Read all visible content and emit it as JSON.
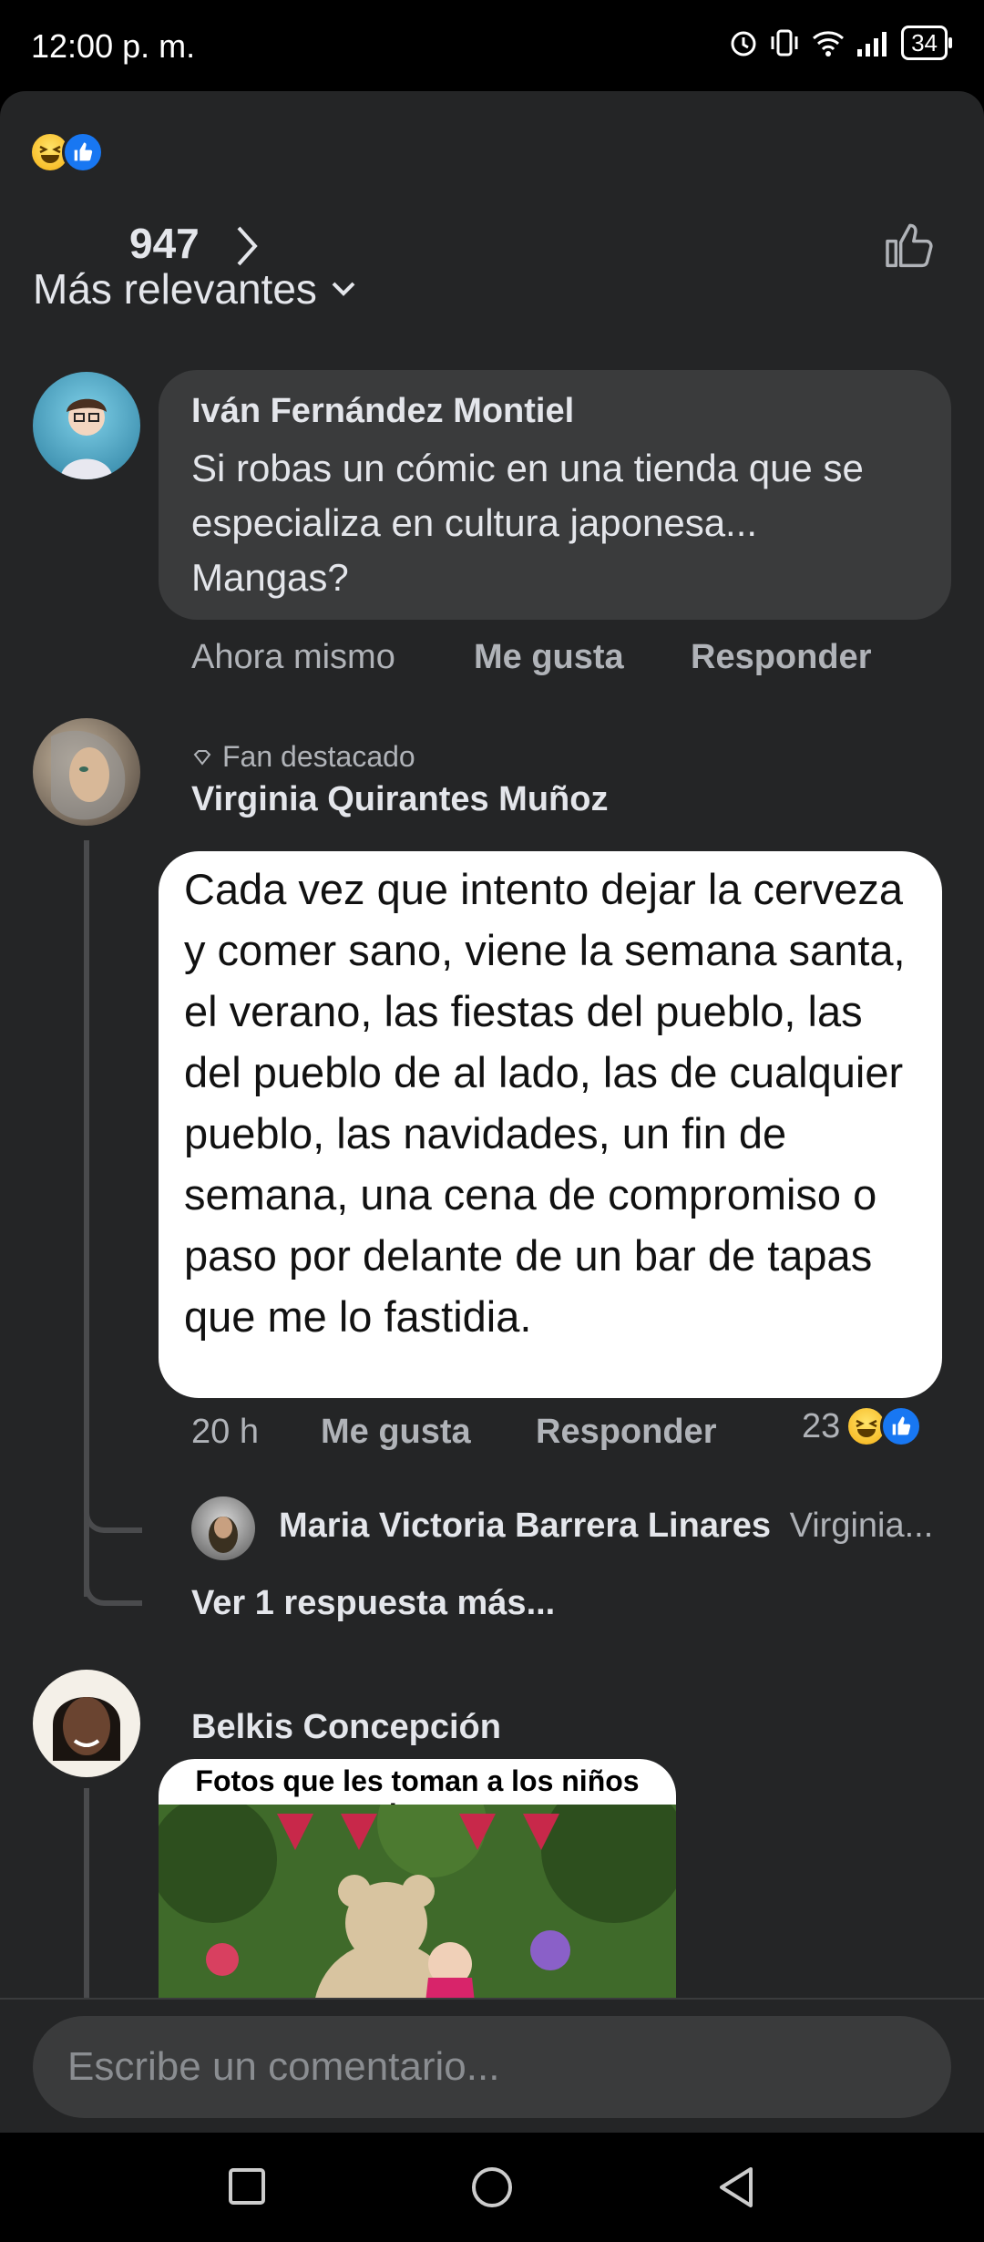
{
  "status_bar": {
    "time": "12:00 p. m.",
    "battery": "34"
  },
  "reactions": {
    "count": "947"
  },
  "sort": {
    "label": "Más relevantes"
  },
  "comments": [
    {
      "author": "Iván Fernández Montiel",
      "text": "Si robas un cómic en una tienda que se especializa en cultura japonesa... Mangas?",
      "time": "Ahora mismo",
      "like_label": "Me gusta",
      "reply_label": "Responder"
    },
    {
      "badge": "Fan destacado",
      "author": "Virginia Quirantes Muñoz",
      "image_text": "Cada vez que intento dejar la cerveza y comer sano, viene la semana santa, el verano, las fiestas del pueblo, las del pueblo de al lado, las de cualquier pueblo, las navidades, un fin de semana, una cena de compromiso o paso por delante de un bar de tapas que me lo fastidia.",
      "time": "20 h",
      "like_label": "Me gusta",
      "reply_label": "Responder",
      "reaction_count": "23",
      "reply_preview": {
        "author": "Maria Victoria Barrera Linares",
        "text": "Virginia..."
      },
      "more_replies": "Ver 1 respuesta más..."
    },
    {
      "author": "Belkis Concepción",
      "image_caption": "Fotos que les toman a los niños ahora:"
    }
  ],
  "composer": {
    "placeholder": "Escribe un comentario..."
  }
}
